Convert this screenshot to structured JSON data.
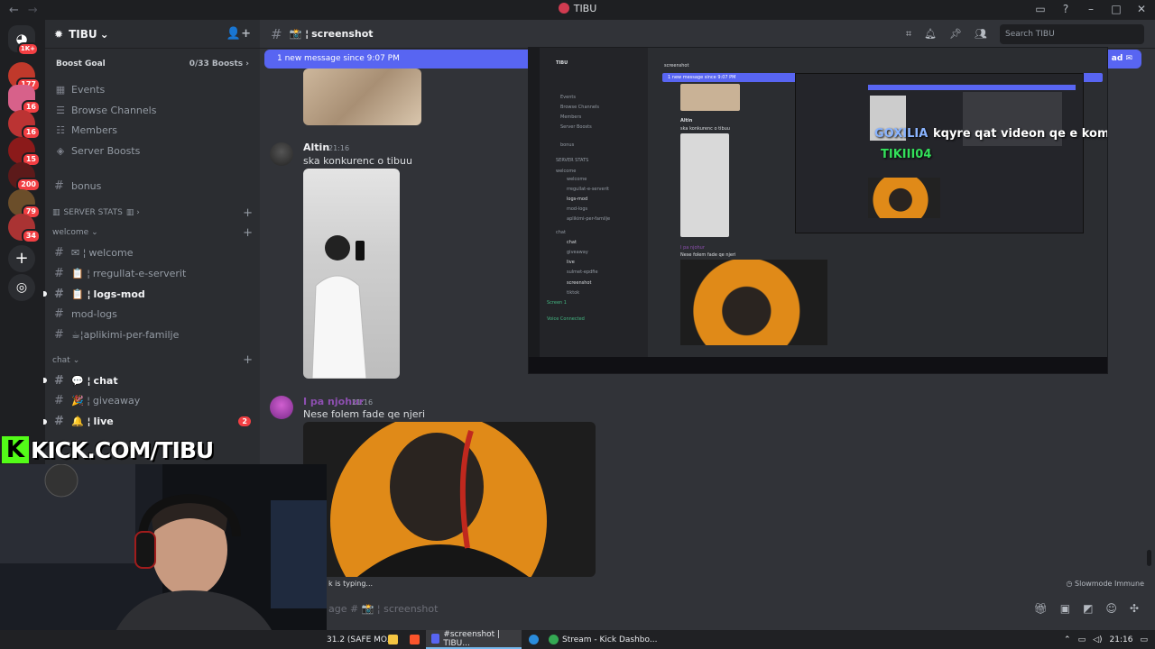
{
  "window": {
    "title": "TIBU"
  },
  "server": {
    "name": "TIBU",
    "boost_goal_label": "Boost Goal",
    "boost_count": "0/33 Boosts"
  },
  "rail": {
    "badges": [
      "1K+",
      "177",
      "16",
      "16",
      "15",
      "200",
      "79",
      "34"
    ]
  },
  "sidebar": {
    "items": [
      {
        "label": "Events",
        "icon": "calendar-icon"
      },
      {
        "label": "Browse Channels",
        "icon": "browse-icon"
      },
      {
        "label": "Members",
        "icon": "members-icon"
      },
      {
        "label": "Server Boosts",
        "icon": "boost-icon"
      }
    ],
    "bonus": "bonus",
    "categories": {
      "server_stats": "SERVER STATS",
      "welcome": "welcome",
      "chat": "chat"
    },
    "welcome_channels": [
      "welcome",
      "rregullat-e-serverit",
      "logs-mod",
      "mod-logs",
      "aplikimi-per-familje"
    ],
    "welcome_prefixes": [
      "✉ ¦",
      "📋 ¦",
      "📋 ¦",
      "",
      "☕¦"
    ],
    "chat_channels": [
      "chat",
      "giveaway",
      "live"
    ],
    "chat_prefixes": [
      "💬 ¦",
      "🎉 ¦",
      "🔔 ¦"
    ],
    "live_mentions": "2"
  },
  "header": {
    "channel": "screenshot",
    "channel_prefix": "📸 ¦",
    "search_placeholder": "Search TIBU"
  },
  "chat": {
    "new_message_bar": "1 new message since 9:07 PM",
    "new_message_mark": "ad",
    "messages": [
      {
        "author": "Altin",
        "time": "21:16",
        "text": "ska konkurenc o tibuu",
        "author_color": "#f2f3f5"
      },
      {
        "author": "I pa njohur",
        "time": "21:16",
        "text": "Nese folem fade qe njeri",
        "author_color": "#a060c0"
      }
    ],
    "typing": "k is typing...",
    "slowmode": "Slowmode Immune",
    "input_placeholder": "age # 📸 ¦ screenshot"
  },
  "embed": {
    "overlay_text": "kqyre qat videon qe e kom qu @TIBU",
    "overlay_name_1": "GOXILIA",
    "overlay_name_2": "TIKIII04",
    "mini_new_message": "1 new message since 9:07 PM",
    "mini_author": "Altin",
    "mini_msg": "ska konkurenc o tibuu",
    "mini_author2": "I pa njohur",
    "mini_msg2": "Nese folem fade qe njeri",
    "mini_channels": [
      "Events",
      "Browse Channels",
      "Members",
      "Server Boosts",
      "bonus",
      "SERVER STATS",
      "welcome",
      "welcome",
      "rregullat-e-serverit",
      "logs-mod",
      "mod-logs",
      "aplikimi-per-familje",
      "chat",
      "chat",
      "giveaway",
      "live",
      "sulmet-epdfie",
      "screenshot",
      "tiktok"
    ],
    "mini_voice": "Voice Connected",
    "mini_screen": "Screen 1"
  },
  "kick": {
    "brand": "KICK.COM/TIBU"
  },
  "taskbar": {
    "items": [
      "31.2 (SAFE MO...",
      "#screenshot | TIBU...",
      "Stream - Kick Dashbo..."
    ],
    "clock": "21:16"
  },
  "colors": {
    "accent": "#5865f2",
    "kick_green": "#53fc18",
    "mention_red": "#f23f43"
  }
}
